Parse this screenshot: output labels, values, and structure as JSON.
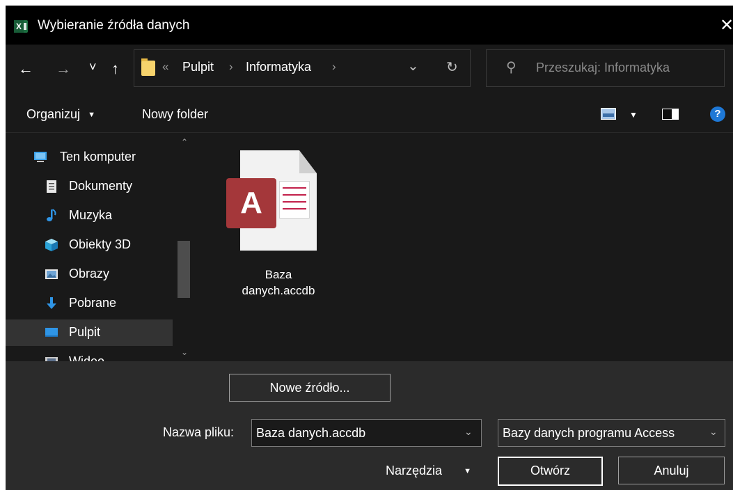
{
  "window": {
    "title": "Wybieranie źródła danych",
    "app_icon_letter": "X",
    "close_glyph": "✕"
  },
  "nav": {
    "back_glyph": "←",
    "forward_glyph": "→",
    "recent_glyph": "˅",
    "up_glyph": "↑"
  },
  "address": {
    "overflow_glyph": "«",
    "sep_glyph": "›",
    "crumbs": [
      "Pulpit",
      "Informatyka"
    ],
    "dropdown_glyph": "⌄",
    "refresh_glyph": "↻"
  },
  "search": {
    "icon": "search-icon",
    "placeholder": "Przeszukaj: Informatyka"
  },
  "toolbar": {
    "organize_label": "Organizuj",
    "organize_caret": "▼",
    "new_folder_label": "Nowy folder",
    "view_caret": "▼",
    "help_glyph": "?"
  },
  "sidebar": {
    "items": [
      {
        "label": "Ten komputer",
        "icon": "computer-icon"
      },
      {
        "label": "Dokumenty",
        "icon": "document-icon"
      },
      {
        "label": "Muzyka",
        "icon": "music-icon"
      },
      {
        "label": "Obiekty 3D",
        "icon": "cube-icon"
      },
      {
        "label": "Obrazy",
        "icon": "image-icon"
      },
      {
        "label": "Pobrane",
        "icon": "download-icon"
      },
      {
        "label": "Pulpit",
        "icon": "desktop-icon",
        "selected": true
      },
      {
        "label": "Wideo",
        "icon": "video-icon"
      }
    ],
    "scroll_up_glyph": "⌃",
    "scroll_down_glyph": "⌄"
  },
  "files": [
    {
      "name_line1": "Baza",
      "name_line2": "danych.accdb",
      "icon": "access-database-icon",
      "icon_letter": "A"
    }
  ],
  "footer": {
    "new_source_label": "Nowe źródło...",
    "filename_label": "Nazwa pliku:",
    "filename_value": "Baza danych.accdb",
    "filetype_value": "Bazy danych programu Access",
    "tools_label": "Narzędzia",
    "tools_caret": "▼",
    "open_label": "Otwórz",
    "cancel_label": "Anuluj",
    "combo_glyph": "⌄"
  },
  "colors": {
    "titlebar_bg": "#000000",
    "body_bg": "#191919",
    "footer_bg": "#2b2b2b",
    "selected_bg": "#333333",
    "accent": "#1e78d6",
    "access_red": "#a4373a"
  }
}
